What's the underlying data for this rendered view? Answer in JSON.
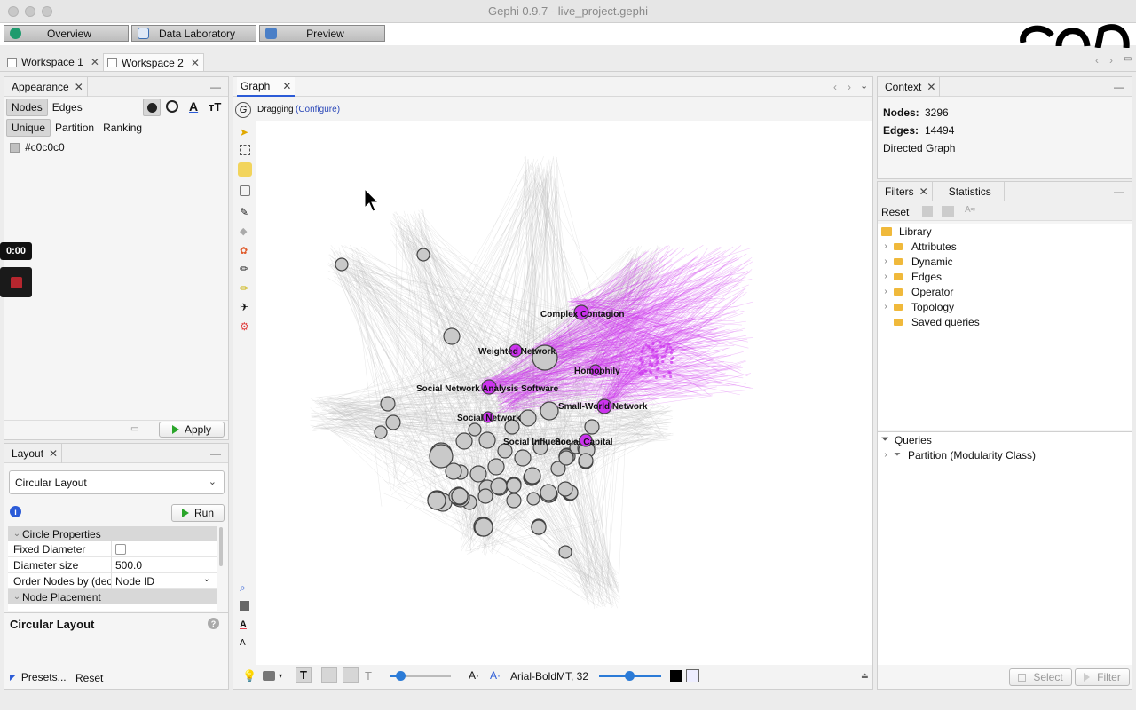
{
  "window": {
    "title": "Gephi 0.9.7 - live_project.gephi"
  },
  "modes": [
    {
      "label": "Overview",
      "color": "#1f9b6e"
    },
    {
      "label": "Data Laboratory",
      "color": "#3a6fb5"
    },
    {
      "label": "Preview",
      "color": "#4a7fc7"
    }
  ],
  "workspaces": [
    "Workspace 1",
    "Workspace 2"
  ],
  "appearance": {
    "title": "Appearance",
    "element_tabs": [
      "Nodes",
      "Edges"
    ],
    "mode_tabs": [
      "Unique",
      "Partition",
      "Ranking"
    ],
    "color_value": "#c0c0c0",
    "apply_label": "Apply"
  },
  "layout": {
    "title": "Layout",
    "selected": "Circular Layout",
    "run_label": "Run",
    "sections": {
      "circle": "Circle Properties",
      "placement": "Node Placement"
    },
    "props": [
      {
        "key": "Fixed Diameter",
        "value": ""
      },
      {
        "key": "Diameter size",
        "value": "500.0"
      },
      {
        "key": "Order Nodes by (decre",
        "value": "Node ID"
      }
    ],
    "description_title": "Circular Layout",
    "presets_label": "Presets...",
    "reset_label": "Reset"
  },
  "recording": {
    "timer": "0:00"
  },
  "graph": {
    "tab": "Graph",
    "mode": "Dragging",
    "configure": "(Configure)",
    "labels": [
      "Complex Contagion",
      "Weighted Network",
      "Homophily",
      "Social Network Analysis Software",
      "Small-World Network",
      "Social Network",
      "Social Influence",
      "Social Capital"
    ],
    "font_label": "Arial-BoldMT, 32",
    "accent": "#cc33ee"
  },
  "context": {
    "title": "Context",
    "nodes_label": "Nodes:",
    "nodes_value": "3296",
    "edges_label": "Edges:",
    "edges_value": "14494",
    "graph_type": "Directed Graph"
  },
  "filters": {
    "tabs": [
      "Filters",
      "Statistics"
    ],
    "reset_label": "Reset",
    "library_label": "Library",
    "library_items": [
      "Attributes",
      "Dynamic",
      "Edges",
      "Operator",
      "Topology",
      "Saved queries"
    ],
    "queries_label": "Queries",
    "query_items": [
      "Partition (Modularity Class)"
    ],
    "select_label": "Select",
    "filter_label": "Filter"
  }
}
